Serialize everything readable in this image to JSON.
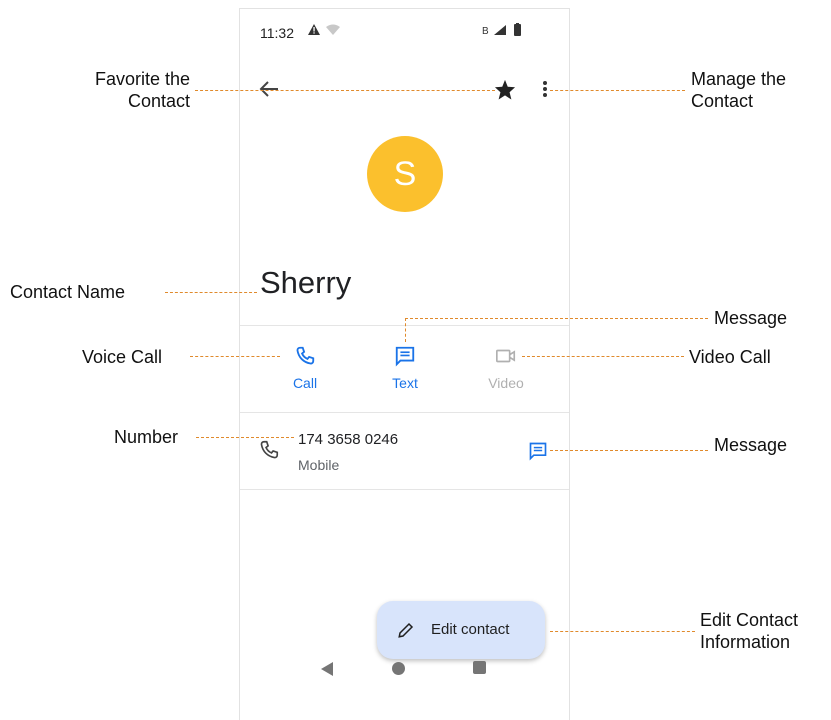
{
  "status_bar": {
    "time": "11:32",
    "left_icons": [
      "alert-icon",
      "wifi-icon"
    ],
    "right_icons": [
      "bluetooth-icon",
      "signal-icon",
      "battery-icon"
    ]
  },
  "app_bar": {
    "icons": [
      "back-arrow-icon",
      "star-icon",
      "more-vert-icon"
    ]
  },
  "contact": {
    "initial": "S",
    "name": "Sherry",
    "avatar_color": "#fbc02d"
  },
  "actions": [
    {
      "label": "Call",
      "icon": "phone-icon",
      "color": "#1a73e8"
    },
    {
      "label": "Text",
      "icon": "message-icon",
      "color": "#1a73e8"
    },
    {
      "label": "Video",
      "icon": "video-icon",
      "color": "#b0b0b0"
    }
  ],
  "phone_entry": {
    "number": "174 3658 0246",
    "type": "Mobile"
  },
  "fab": {
    "label": "Edit contact",
    "icon": "pencil-icon"
  },
  "nav_bar": {
    "icons": [
      "back-triangle-icon",
      "home-circle-icon",
      "recents-square-icon"
    ]
  },
  "annotations": {
    "favorite": [
      "Favorite the",
      "Contact"
    ],
    "manage": [
      "Manage the",
      "Contact"
    ],
    "contact_name": "Contact Name",
    "message_top": "Message",
    "voice_call": "Voice Call",
    "video_call": "Video Call",
    "number": "Number",
    "message_row": "Message",
    "edit": [
      "Edit Contact",
      "Information"
    ]
  },
  "colors": {
    "accent": "#1a73e8",
    "callout_line": "#e08a2c",
    "fab_bg": "#d8e4fb"
  }
}
